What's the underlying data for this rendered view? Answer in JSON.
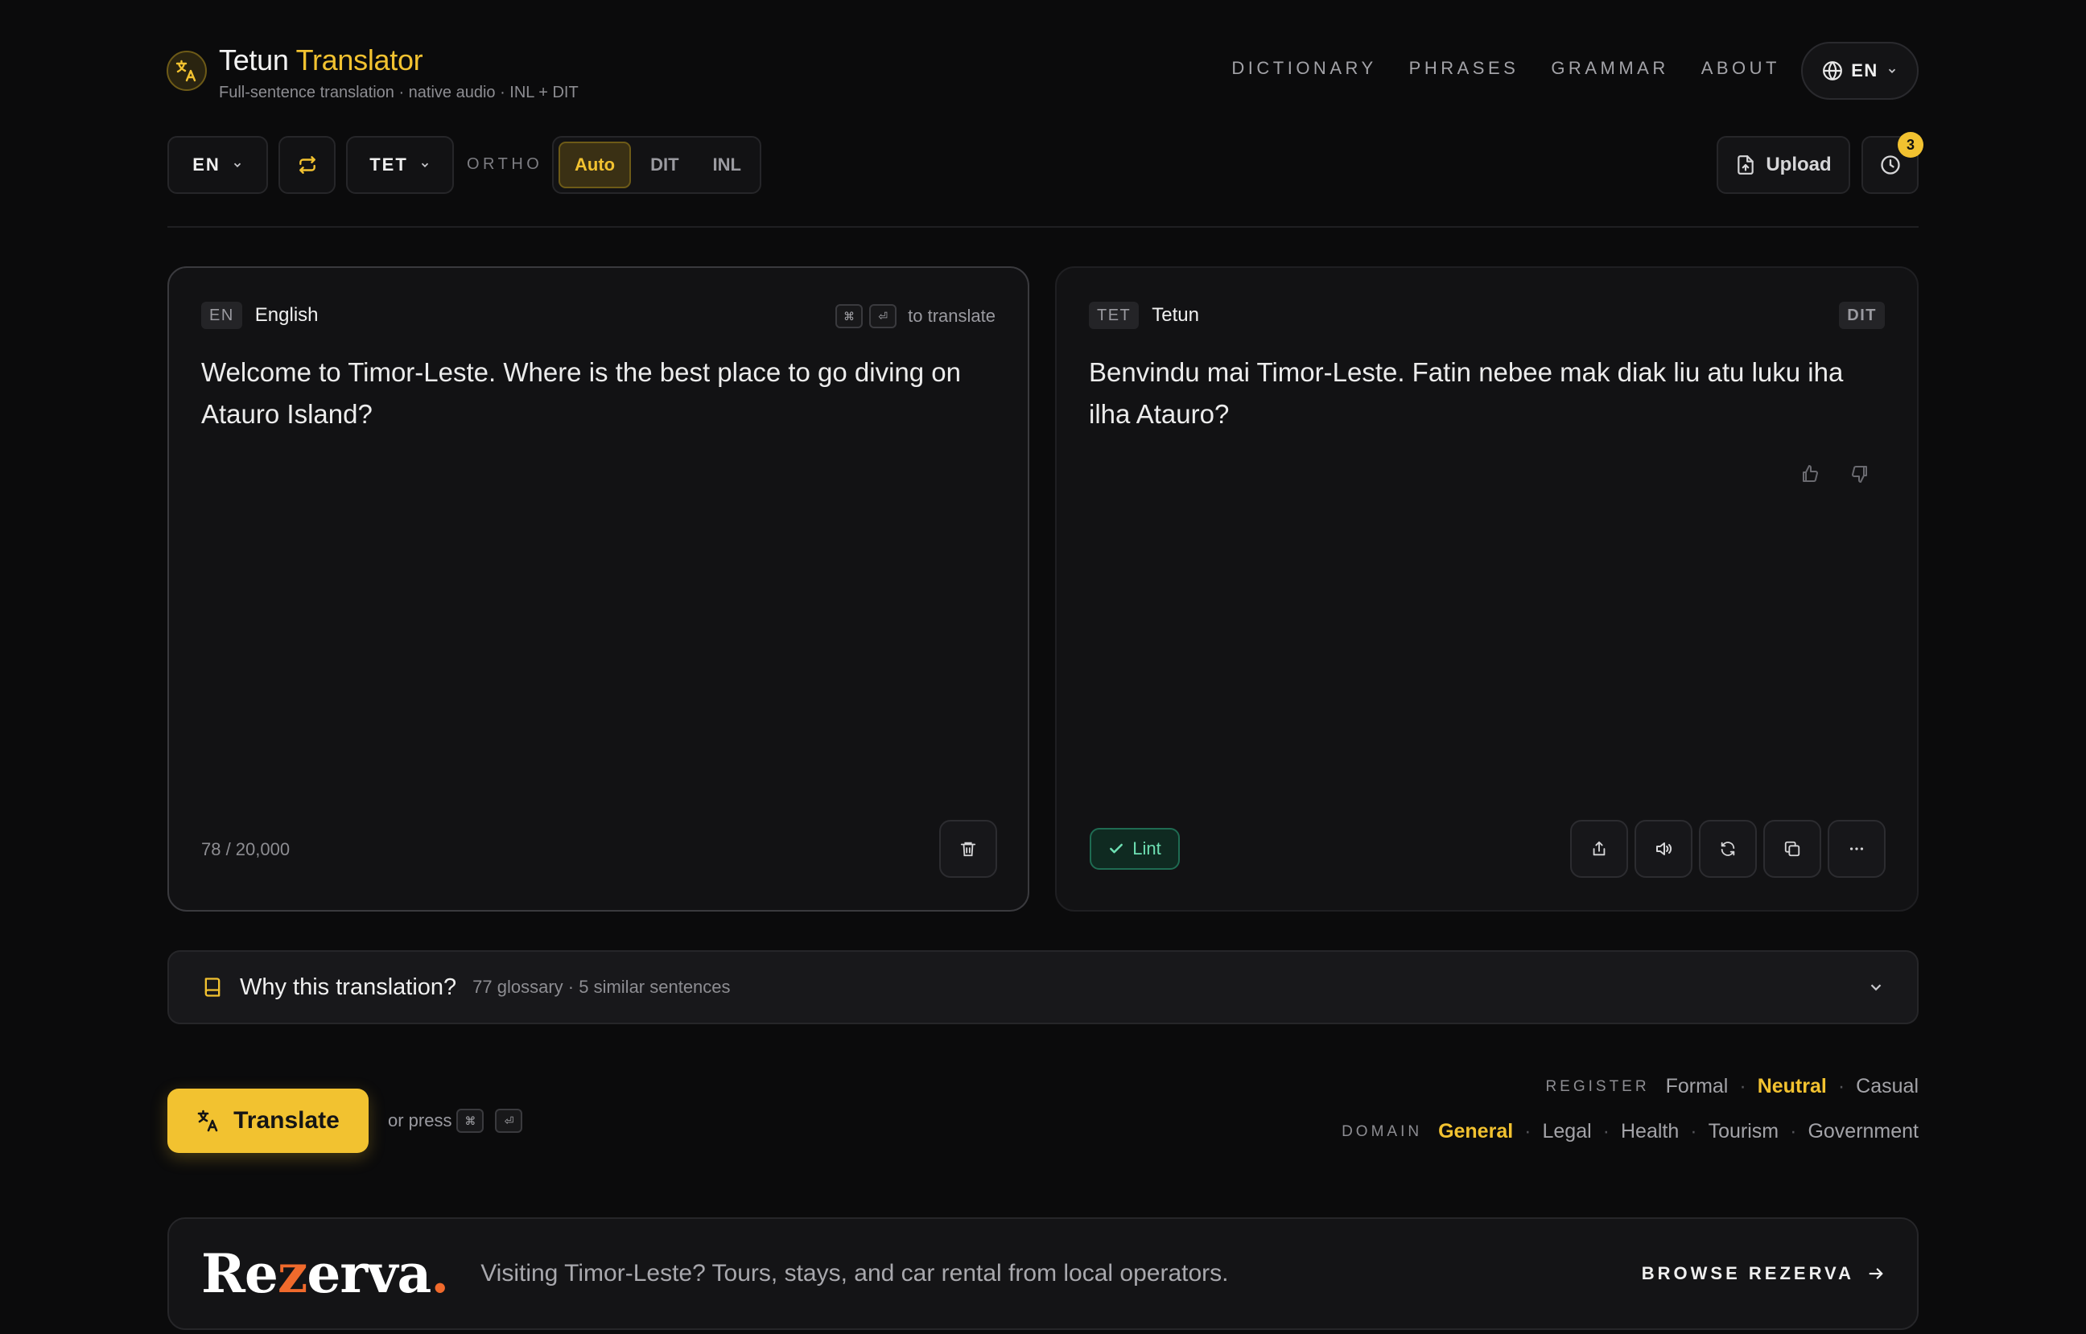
{
  "header": {
    "brand_main": "Tetun",
    "brand_accent": "Translator",
    "tagline": "Full-sentence translation · native audio · INL + DIT",
    "nav": [
      "DICTIONARY",
      "PHRASES",
      "GRAMMAR",
      "ABOUT"
    ],
    "ui_language": "EN"
  },
  "toolbar": {
    "source_lang": "EN",
    "target_lang": "TET",
    "ortho_label": "ORTHO",
    "ortho_options": [
      "Auto",
      "DIT",
      "INL"
    ],
    "ortho_selected": "Auto",
    "upload_label": "Upload",
    "history_count": "3"
  },
  "source_panel": {
    "code": "EN",
    "name": "English",
    "shortcut_keys": [
      "⌘",
      "⏎"
    ],
    "shortcut_hint": "to translate",
    "text": "Welcome to Timor-Leste. Where is the best place to go diving on Atauro Island?",
    "char_count": "78 / 20,000"
  },
  "target_panel": {
    "code": "TET",
    "name": "Tetun",
    "ortho_badge": "DIT",
    "text": "Benvindu mai Timor-Leste. Fatin nebee mak diak liu atu luku iha ilha Atauro?",
    "lint_label": "Lint"
  },
  "why": {
    "title": "Why this translation?",
    "summary": "77 glossary · 5 similar sentences"
  },
  "actions": {
    "translate_label": "Translate",
    "press_text": "or press",
    "keys": [
      "⌘",
      "⏎"
    ]
  },
  "register": {
    "label": "REGISTER",
    "options": [
      "Formal",
      "Neutral",
      "Casual"
    ],
    "selected": "Neutral"
  },
  "domain": {
    "label": "DOMAIN",
    "options": [
      "General",
      "Legal",
      "Health",
      "Tourism",
      "Government"
    ],
    "selected": "General"
  },
  "banner": {
    "logo_parts": [
      "Re",
      "z",
      "erva",
      "."
    ],
    "text": "Visiting Timor-Leste? Tours, stays, and car rental from local operators.",
    "cta": "BROWSE REZERVA"
  },
  "colors": {
    "accent": "#f2c230",
    "background": "#0b0b0c",
    "panel": "#121214",
    "success": "#6ee0b3",
    "rezerva_orange": "#f06a2c"
  }
}
